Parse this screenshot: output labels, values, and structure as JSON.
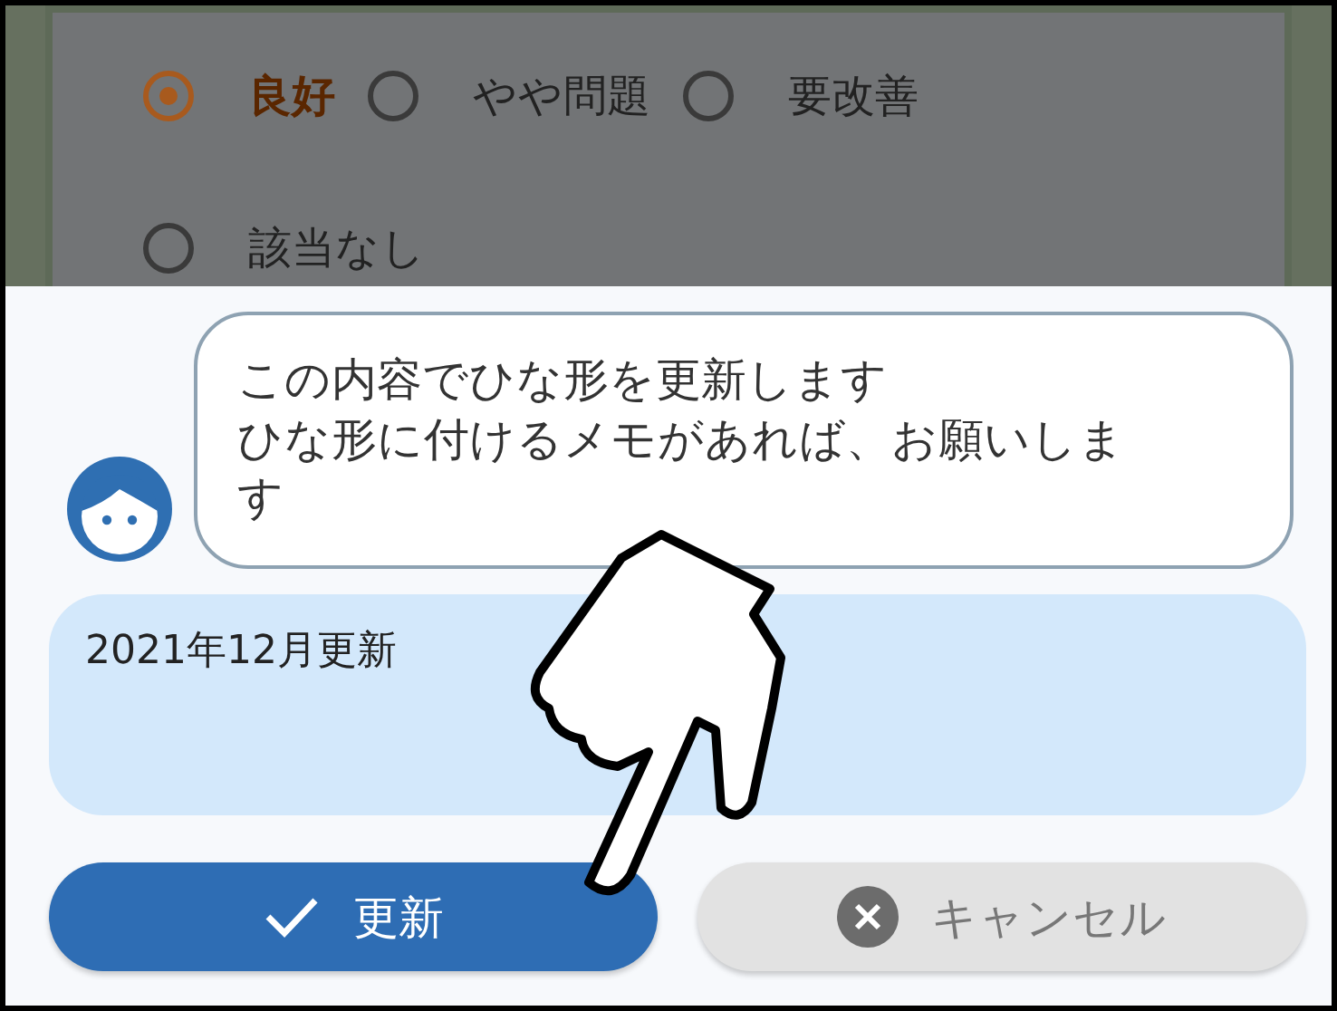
{
  "options": [
    {
      "label": "良好",
      "selected": true
    },
    {
      "label": "やや問題",
      "selected": false
    },
    {
      "label": "要改善",
      "selected": false
    },
    {
      "label": "該当なし",
      "selected": false
    }
  ],
  "message": [
    "この内容でひな形を更新します",
    "ひな形に付けるメモがあれば、お願いします"
  ],
  "memo": {
    "value": "2021年12月更新"
  },
  "buttons": [
    {
      "label": "更新",
      "kind": "primary"
    },
    {
      "label": "キャンセル",
      "kind": "cancel"
    }
  ]
}
